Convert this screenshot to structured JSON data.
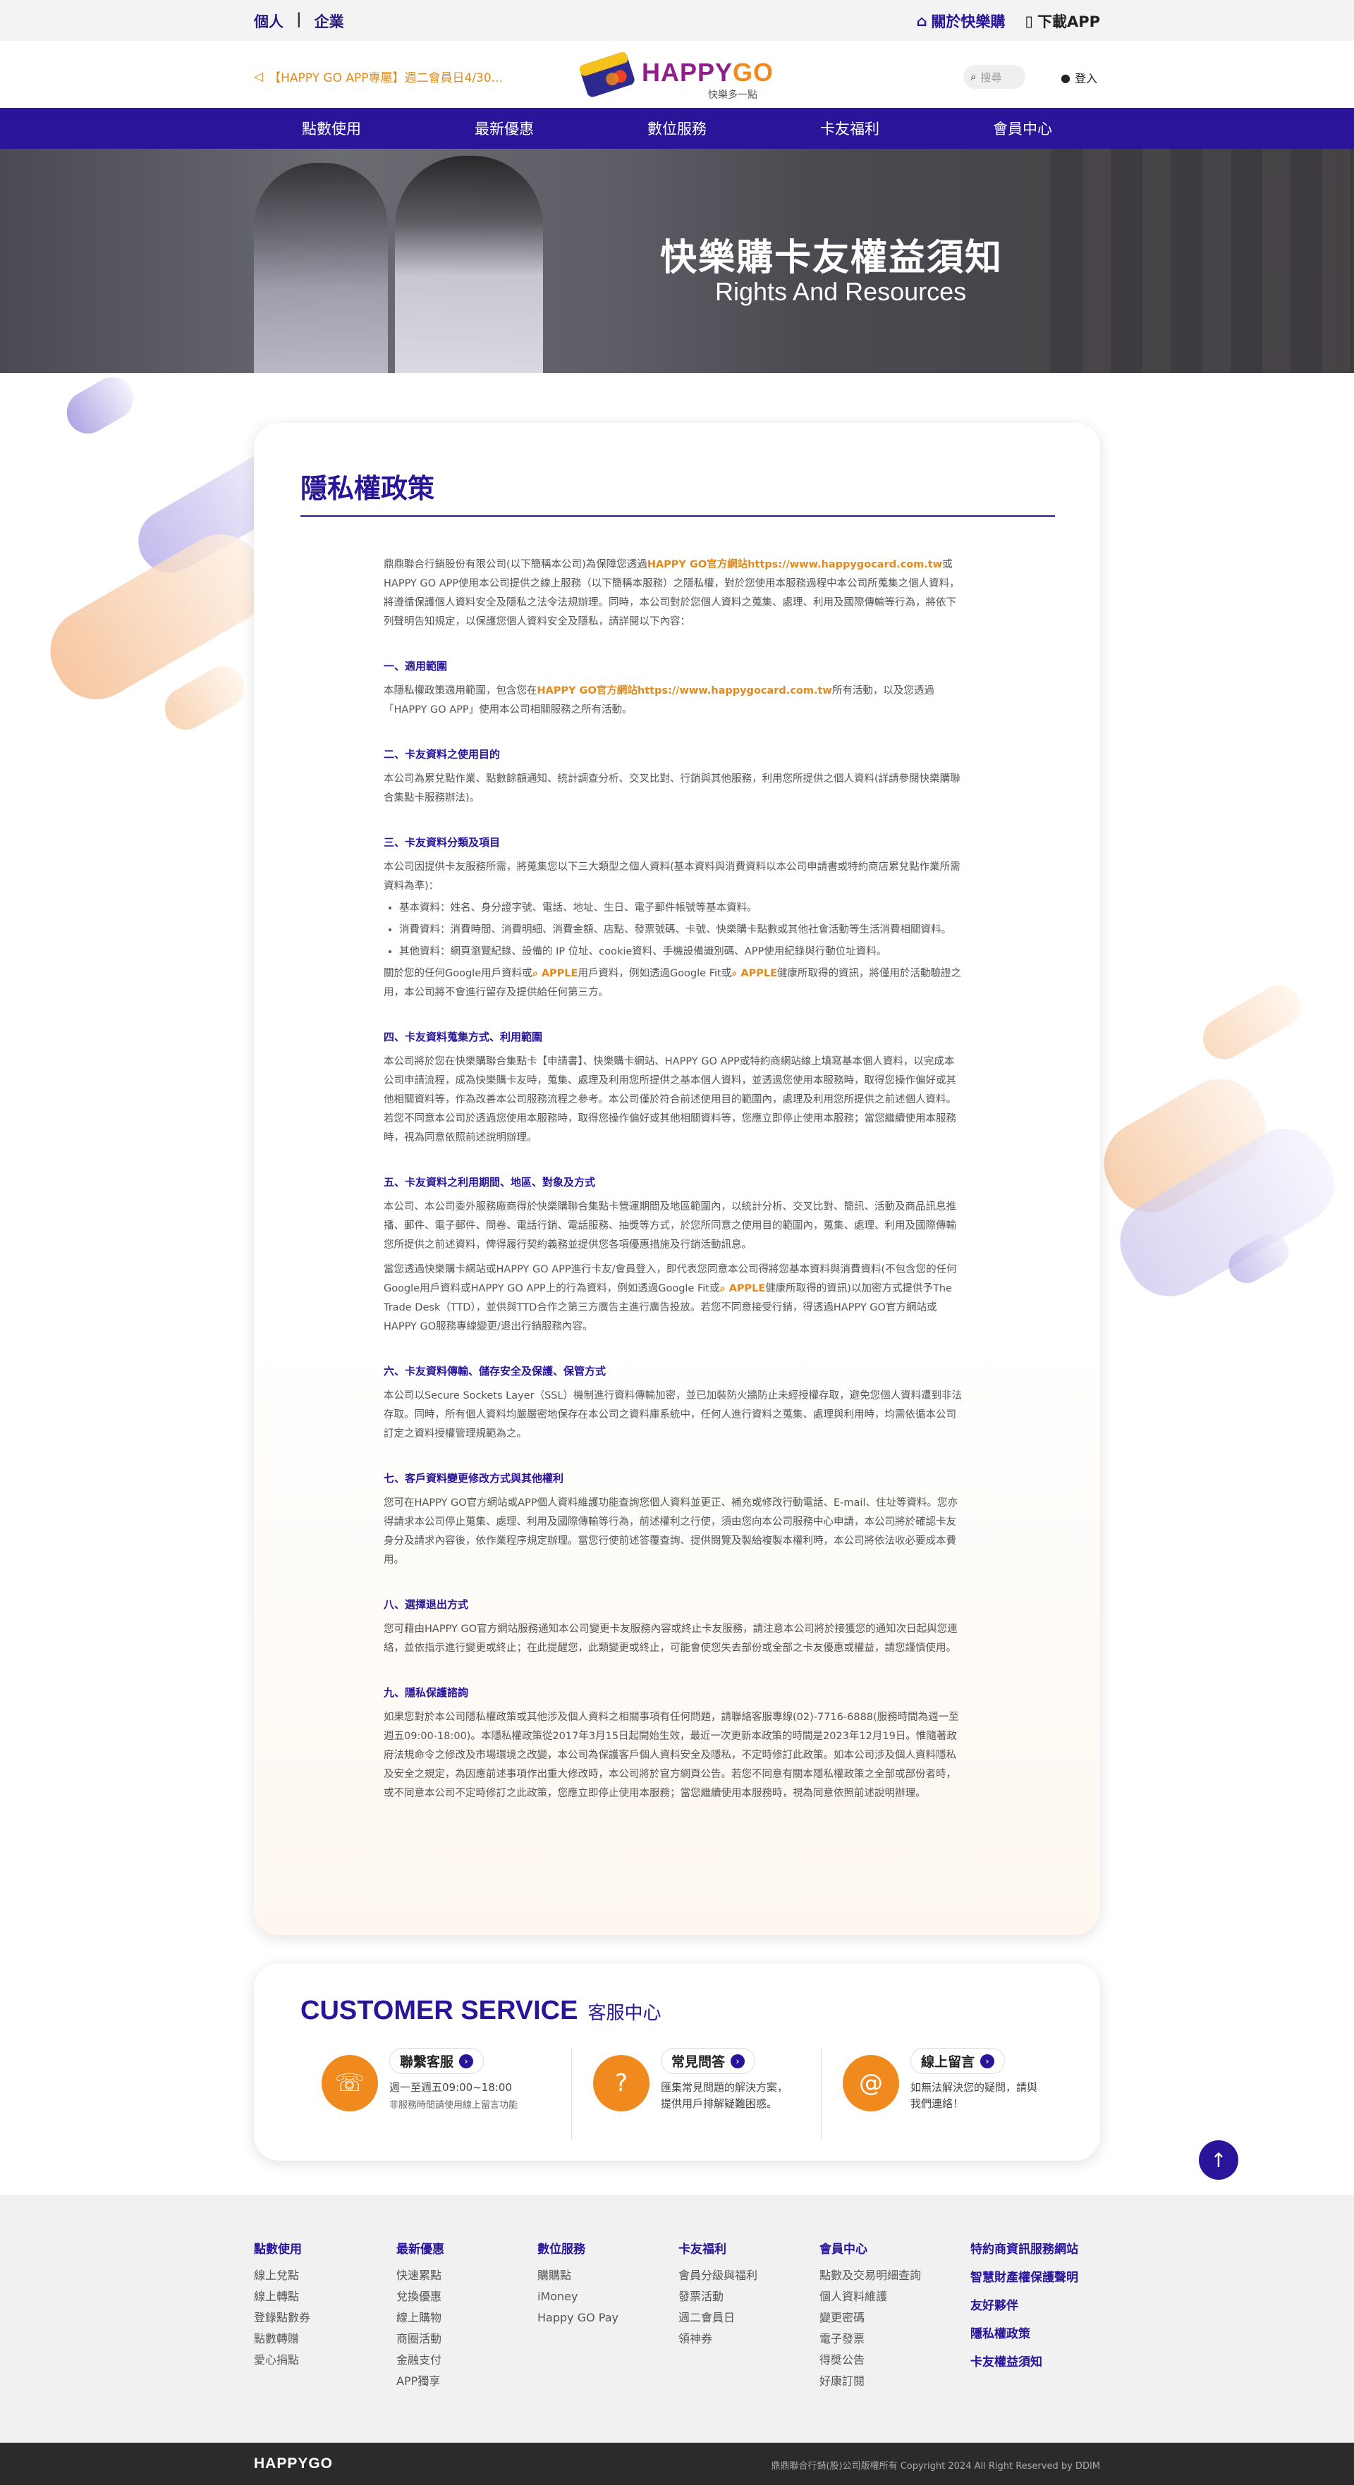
{
  "topbar": {
    "personal": "個人",
    "business": "企業",
    "about": "關於快樂購",
    "download": "下載APP"
  },
  "header": {
    "promo": "【HAPPY GO APP專屬】週二會員日4/30...",
    "logo_brand_happy": "HAPPY",
    "logo_brand_go": "GO",
    "logo_tagline": "快樂多一點",
    "search_placeholder": "搜尋",
    "login": "登入"
  },
  "nav": [
    "點數使用",
    "最新優惠",
    "數位服務",
    "卡友福利",
    "會員中心"
  ],
  "banner": {
    "title": "快樂購卡友權益須知",
    "subtitle": "Rights And Resources"
  },
  "policy": {
    "title": "隱私權政策",
    "intro_1": "鼎鼎聯合行銷股份有限公司(以下簡稱本公司)為保障您透過",
    "intro_link": "HAPPY GO官方網站https://www.happygocard.com.tw",
    "intro_2": "或HAPPY GO APP使用本公司提供之線上服務（以下簡稱本服務）之隱私權，對於您使用本服務過程中本公司所蒐集之個人資料，將遵循保護個人資料安全及隱私之法令法規辦理。同時，本公司對於您個人資料之蒐集、處理、利用及國際傳輸等行為，將依下列聲明告知規定，以保護您個人資料安全及隱私，請詳閱以下內容：",
    "s1_title": "一、適用範圍",
    "s1_a": "本隱私權政策適用範圍，包含您在",
    "s1_link": "HAPPY GO官方網站https://www.happygocard.com.tw",
    "s1_b": "所有活動，以及您透過「HAPPY GO APP」使用本公司相關服務之所有活動。",
    "s2_title": "二、卡友資料之使用目的",
    "s2_p": "本公司為累兌點作業、點數餘額通知、統計調查分析、交叉比對、行銷與其他服務，利用您所提供之個人資料(詳請參閱快樂購聯合集點卡服務辦法)。",
    "s3_title": "三、卡友資料分類及項目",
    "s3_p": "本公司因提供卡友服務所需，將蒐集您以下三大類型之個人資料(基本資料與消費資料以本公司申請書或特約商店累兌點作業所需資料為準)：",
    "s3_items": [
      "基本資料：姓名、身分證字號、電話、地址、生日、電子郵件帳號等基本資料。",
      "消費資料：消費時間、消費明細、消費金額、店點、發票號碼、卡號、快樂購卡點數或其他社會活動等生活消費相關資料。",
      "其他資料：網頁瀏覽紀錄、設備的 IP 位址、cookie資料、手機設備識別碼、APP使用紀錄與行動位址資料。"
    ],
    "s3_after_1": "關於您的任何Google用戶資料或",
    "s3_apple_1": "APPLE",
    "s3_after_2": "用戶資料，例如透過Google Fit或",
    "s3_apple_2": "APPLE",
    "s3_after_3": "健康所取得的資訊，將僅用於活動驗證之用，本公司將不會進行留存及提供給任何第三方。",
    "s4_title": "四、卡友資料蒐集方式、利用範圍",
    "s4_p": "本公司將於您在快樂購聯合集點卡【申請書】、快樂購卡網站、HAPPY GO APP或特約商網站線上填寫基本個人資料，以完成本公司申請流程，成為快樂購卡友時，蒐集、處理及利用您所提供之基本個人資料，並透過您使用本服務時，取得您操作偏好或其他相關資料等，作為改善本公司服務流程之參考。本公司僅於符合前述使用目的範圍內，處理及利用您所提供之前述個人資料。若您不同意本公司於透過您使用本服務時，取得您操作偏好或其他相關資料等，您應立即停止使用本服務；當您繼續使用本服務時，視為同意依照前述說明辦理。",
    "s5_title": "五、卡友資料之利用期間、地區、對象及方式",
    "s5_p1": "本公司、本公司委外服務廠商得於快樂購聯合集點卡營運期間及地區範圍內，以統計分析、交叉比對、簡訊、活動及商品訊息推播、郵件、電子郵件、問卷、電話行銷、電話服務、抽獎等方式，於您所同意之使用目的範圍內，蒐集、處理、利用及國際傳輸您所提供之前述資料，俾得履行契約義務並提供您各項優惠措施及行銷活動訊息。",
    "s5_p2a": "當您透過快樂購卡網站或HAPPY GO APP進行卡友/會員登入，即代表您同意本公司得將您基本資料與消費資料(不包含您的任何Google用戶資料或HAPPY GO APP上的行為資料，例如透過Google Fit或",
    "s5_apple": "APPLE",
    "s5_p2b": "健康所取得的資訊)以加密方式提供予The Trade Desk（TTD），並供與TTD合作之第三方廣告主進行廣告投放。若您不同意接受行銷，得透過HAPPY GO官方網站或HAPPY GO服務專線變更/退出行銷服務內容。",
    "s6_title": "六、卡友資料傳輸、儲存安全及保護、保管方式",
    "s6_p": "本公司以Secure Sockets Layer（SSL）機制進行資料傳輸加密，並已加裝防火牆防止未經授權存取，避免您個人資料遭到非法存取。同時，所有個人資料均嚴嚴密地保存在本公司之資料庫系統中，任何人進行資料之蒐集、處理與利用時，均需依循本公司訂定之資料授權管理規範為之。",
    "s7_title": "七、客戶資料變更修改方式與其他權利",
    "s7_p": "您可在HAPPY GO官方網站或APP個人資料維護功能查詢您個人資料並更正、補充或修改行動電話、E-mail、住址等資料。您亦得請求本公司停止蒐集、處理、利用及國際傳輸等行為，前述權利之行使，須由您向本公司服務中心申請，本公司將於確認卡友身分及請求內容後，依作業程序規定辦理。當您行使前述答覆查詢、提供閱覽及製給複製本權利時，本公司將依法收必要成本費用。",
    "s8_title": "八、選擇退出方式",
    "s8_p": "您可藉由HAPPY GO官方網站服務通知本公司變更卡友服務內容或終止卡友服務，請注意本公司將於接獲您的通知次日起與您連絡，並依指示進行變更或終止；在此提醒您，此類變更或終止，可能會使您失去部份或全部之卡友優惠或權益，請您謹慎使用。",
    "s9_title": "九、隱私保護諮詢",
    "s9_p": "如果您對於本公司隱私權政策或其他涉及個人資料之相關事項有任何問題，請聯絡客服專線(02)-7716-6888(服務時間為週一至週五09:00-18:00)。本隱私權政策從2017年3月15日起開始生效，最近一次更新本政策的時間是2023年12月19日。惟隨著政府法規命令之修改及市場環境之改變，本公司為保護客戶個人資料安全及隱私，不定時修訂此政策。如本公司涉及個人資料隱私及安全之規定，為因應前述事項作出重大修改時，本公司將於官方網頁公告。若您不同意有關本隱私權政策之全部或部份者時，或不同意本公司不定時修訂之此政策，您應立即停止使用本服務；當您繼續使用本服務時，視為同意依照前述說明辦理。"
  },
  "customer_service": {
    "title_en": "CUSTOMER SERVICE",
    "title_zh": "客服中心",
    "items": [
      {
        "label": "聯繫客服",
        "desc1": "週一至週五09:00~18:00",
        "desc2": "非服務時間請使用線上留言功能"
      },
      {
        "label": "常見問答",
        "desc1": "匯集常見問題的解決方案，",
        "desc2": "提供用戶排解疑難困惑。"
      },
      {
        "label": "線上留言",
        "desc1": "如無法解決您的疑問，請與",
        "desc2": "我們連絡！"
      }
    ]
  },
  "footer": {
    "cols": [
      {
        "title": "點數使用",
        "items": [
          "線上兌點",
          "線上轉點",
          "登錄點數券",
          "點數轉贈",
          "愛心捐點"
        ]
      },
      {
        "title": "最新優惠",
        "items": [
          "快速累點",
          "兌換優惠",
          "線上購物",
          "商圈活動",
          "金融支付",
          "APP獨享"
        ]
      },
      {
        "title": "數位服務",
        "items": [
          "購購點",
          "iMoney",
          "Happy GO Pay"
        ]
      },
      {
        "title": "卡友福利",
        "items": [
          "會員分級與福利",
          "發票活動",
          "週二會員日",
          "領神券"
        ]
      },
      {
        "title": "會員中心",
        "items": [
          "點數及交易明細查詢",
          "個人資料維護",
          "變更密碼",
          "電子發票",
          "得獎公告",
          "好康訂閱"
        ]
      }
    ],
    "links": [
      "特約商資訊服務網站",
      "智慧財產權保護聲明",
      "友好夥伴",
      "隱私權政策",
      "卡友權益須知"
    ],
    "brand": "HAPPYGO",
    "copyright": "鼎鼎聯合行銷(股)公司版權所有 Copyright 2024 All Right Reserved by DDIM"
  },
  "colors": {
    "brand_purple": "#29149a",
    "accent_orange": "#f08a1e"
  }
}
